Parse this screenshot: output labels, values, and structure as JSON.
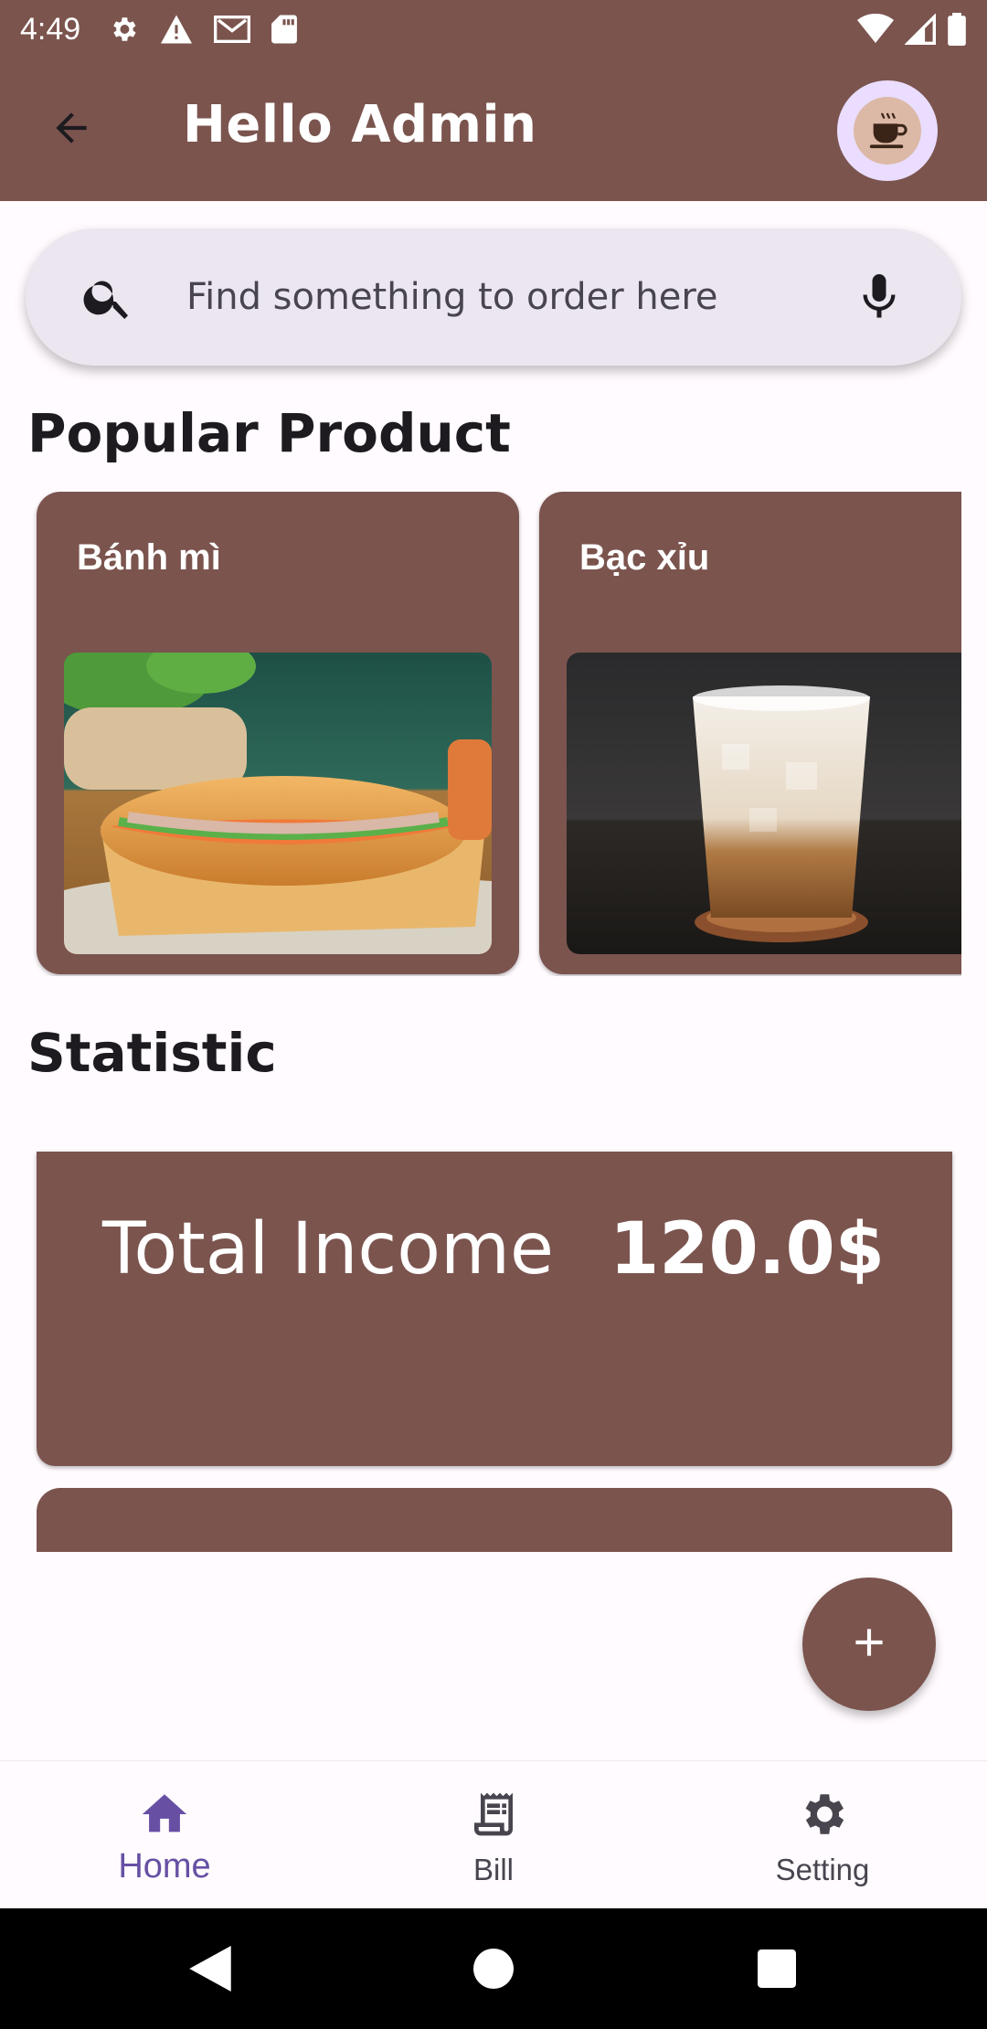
{
  "status_bar": {
    "time": "4:49",
    "icons_left": [
      "gear-icon",
      "warning-icon",
      "gmail-icon",
      "sd-card-icon"
    ],
    "icons_right": [
      "wifi-icon",
      "signal-icon",
      "battery-icon"
    ]
  },
  "app_bar": {
    "title": "Hello Admin",
    "back_icon": "arrow-back-icon",
    "avatar_icon": "coffee-cup-icon"
  },
  "search": {
    "placeholder": "Find something to order here",
    "value": "",
    "left_icon": "search-icon",
    "right_icon": "mic-icon"
  },
  "popular": {
    "title": "Popular Product",
    "products": [
      {
        "name": "Bánh mì",
        "image": "banh-mi-sandwich"
      },
      {
        "name": "Bạc xỉu",
        "image": "iced-milk-coffee"
      }
    ]
  },
  "statistic": {
    "title": "Statistic",
    "cards": [
      {
        "label": "Total Income",
        "value": "120.0$"
      }
    ]
  },
  "fab": {
    "icon": "plus-icon"
  },
  "bottom_nav": {
    "items": [
      {
        "label": "Home",
        "icon": "home-icon",
        "active": true
      },
      {
        "label": "Bill",
        "icon": "receipt-icon",
        "active": false
      },
      {
        "label": "Setting",
        "icon": "gear-icon",
        "active": false
      }
    ]
  },
  "colors": {
    "primary": "#7b544e",
    "background": "#fffbfe",
    "search_bg": "#ece6f0",
    "active_nav": "#6750a4"
  }
}
